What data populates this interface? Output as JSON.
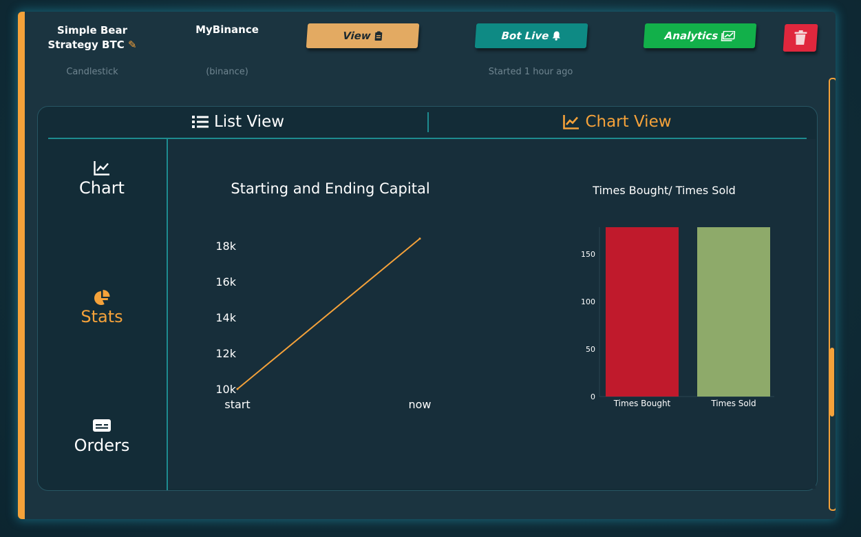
{
  "bot": {
    "name": "Simple Bear Strategy BTC",
    "type": "Candlestick",
    "exchange_name": "MyBinance",
    "exchange_id": "(binance)",
    "started": "Started 1 hour ago"
  },
  "buttons": {
    "view": "View",
    "bot_live": "Bot Live",
    "analytics": "Analytics"
  },
  "tabs": {
    "list_view": "List View",
    "chart_view": "Chart View",
    "active": "chart_view"
  },
  "sidebar": {
    "items": [
      {
        "label": "Chart",
        "icon": "line-chart-icon"
      },
      {
        "label": "Stats",
        "icon": "pie-chart-icon"
      },
      {
        "label": "Orders",
        "icon": "id-card-icon"
      }
    ],
    "active": "Stats"
  },
  "colors": {
    "accent": "#f5a23a",
    "teal": "#1e8c90",
    "bought": "#c01a2c",
    "sold": "#8eaa6a",
    "view_button": "#e3aa62",
    "live_button": "#0e8a84",
    "analytics_button": "#12b04a",
    "delete_button": "#e0273d"
  },
  "chart_data": [
    {
      "type": "line",
      "title": "Starting and Ending Capital",
      "categories": [
        "start",
        "now"
      ],
      "values": [
        10000,
        18400
      ],
      "yticks": [
        "10k",
        "12k",
        "14k",
        "16k",
        "18k"
      ],
      "ylim": [
        10000,
        18000
      ],
      "grid": false
    },
    {
      "type": "bar",
      "title": "Times Bought/ Times Sold",
      "categories": [
        "Times Bought",
        "Times Sold"
      ],
      "values": [
        186,
        184
      ],
      "yticks": [
        "0",
        "50",
        "100",
        "150"
      ],
      "ylim": [
        0,
        150
      ],
      "grid": false
    }
  ]
}
